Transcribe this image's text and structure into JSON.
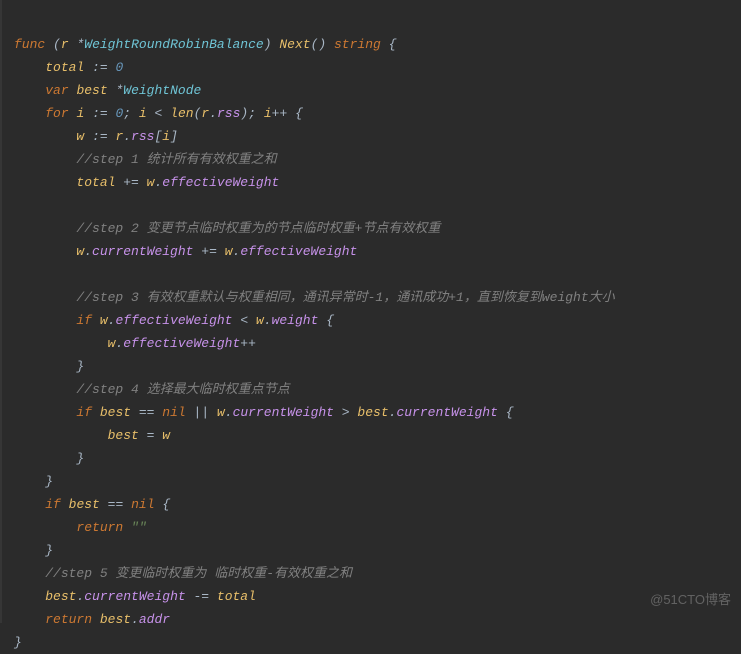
{
  "code": {
    "l1": {
      "kw_func": "func",
      "paren_o": "(",
      "recv": "r",
      "star": "*",
      "type": "WeightRoundRobinBalance",
      "paren_c": ")",
      "fn": "Next",
      "paren_o2": "(",
      "paren_c2": ")",
      "ret_type": "string",
      "brace": "{"
    },
    "l2": {
      "total": "total",
      "op": ":= ",
      "zero": "0"
    },
    "l3": {
      "var": "var",
      "best": "best",
      "star": "*",
      "type": "WeightNode"
    },
    "l4": {
      "for": "for",
      "i": "i",
      "assign": ":= ",
      "zero": "0",
      "semi": ";",
      "i2": "i",
      "lt": "<",
      "len": "len",
      "paren_o": "(",
      "r": "r",
      "dot": ".",
      "rss": "rss",
      "paren_c": ")",
      "semi2": ";",
      "i3": "i",
      "inc": "++",
      "brace": "{"
    },
    "l5": {
      "w": "w",
      "assign": ":= ",
      "r": "r",
      "dot": ".",
      "rss": "rss",
      "brk_o": "[",
      "i": "i",
      "brk_c": "]"
    },
    "l6": {
      "cmt": "//step 1 统计所有有效权重之和"
    },
    "l7": {
      "total": "total",
      "op": "+= ",
      "w": "w",
      "dot": ".",
      "field": "effectiveWeight"
    },
    "l8": {
      "blank": ""
    },
    "l9": {
      "cmt": "//step 2 变更节点临时权重为的节点临时权重+节点有效权重"
    },
    "l10": {
      "w": "w",
      "dot": ".",
      "cw": "currentWeight",
      "op": "+= ",
      "w2": "w",
      "dot2": ".",
      "ew": "effectiveWeight"
    },
    "l11": {
      "blank": ""
    },
    "l12": {
      "cmt": "//step 3 有效权重默认与权重相同，通讯异常时-1，通讯成功+1，直到恢复到weight大小"
    },
    "l13": {
      "if": "if",
      "w": "w",
      "dot": ".",
      "ew": "effectiveWeight",
      "lt": "<",
      "w2": "w",
      "dot2": ".",
      "weight": "weight",
      "brace": "{"
    },
    "l14": {
      "w": "w",
      "dot": ".",
      "ew": "effectiveWeight",
      "inc": "++"
    },
    "l15": {
      "brace": "}"
    },
    "l16": {
      "cmt": "//step 4 选择最大临时权重点节点"
    },
    "l17": {
      "if": "if",
      "best": "best",
      "eq": "==",
      "nil": "nil",
      "or": "||",
      "w": "w",
      "dot": ".",
      "cw": "currentWeight",
      "gt": ">",
      "best2": "best",
      "dot2": ".",
      "cw2": "currentWeight",
      "brace": "{"
    },
    "l18": {
      "best": "best",
      "eq": "=",
      "w": "w"
    },
    "l19": {
      "brace": "}"
    },
    "l20": {
      "brace": "}"
    },
    "l21": {
      "if": "if",
      "best": "best",
      "eq": "==",
      "nil": "nil",
      "brace": "{"
    },
    "l22": {
      "ret": "return",
      "str": "\"\""
    },
    "l23": {
      "brace": "}"
    },
    "l24": {
      "cmt": "//step 5 变更临时权重为 临时权重-有效权重之和"
    },
    "l25": {
      "best": "best",
      "dot": ".",
      "cw": "currentWeight",
      "op": "-= ",
      "total": "total"
    },
    "l26": {
      "ret": "return",
      "best": "best",
      "dot": ".",
      "addr": "addr"
    },
    "l27": {
      "brace": "}"
    }
  },
  "watermark": "@51CTO博客"
}
